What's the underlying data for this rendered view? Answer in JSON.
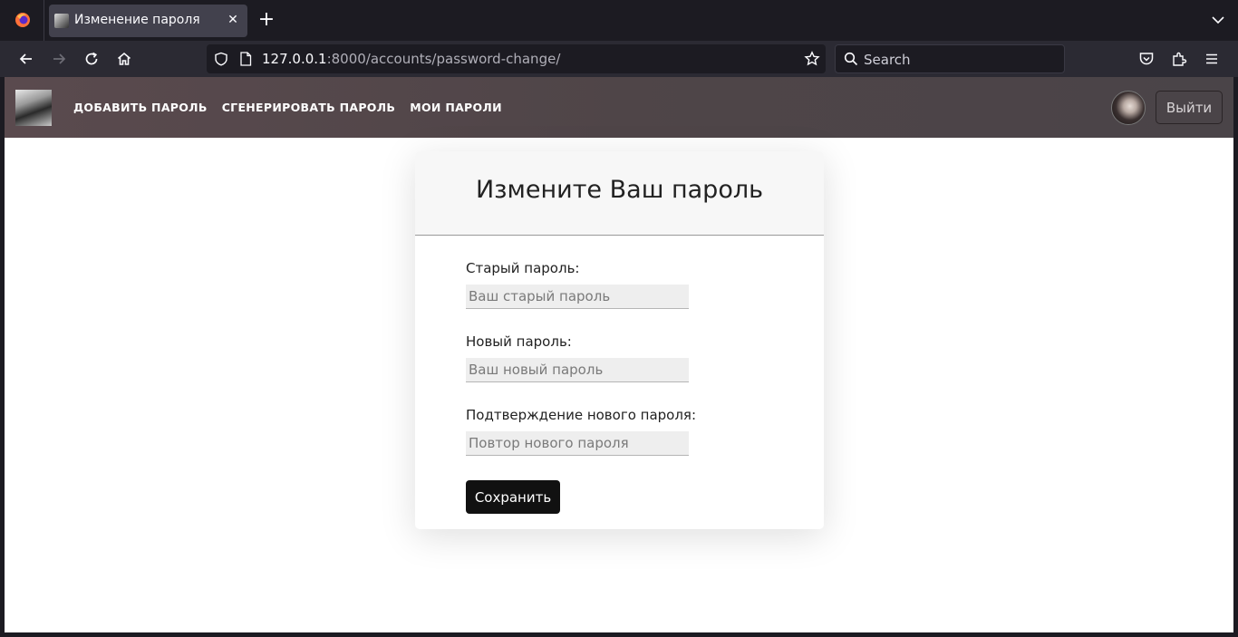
{
  "browser": {
    "tab_title": "Изменение пароля",
    "tab_close": "✕",
    "new_tab": "+",
    "url_host": "127.0.0.1",
    "url_rest": ":8000/accounts/password-change/",
    "search_placeholder": "Search",
    "icons": [
      "firefox-logo-icon",
      "back-arrow-icon",
      "forward-arrow-icon",
      "reload-icon",
      "home-icon",
      "shield-icon",
      "page-icon",
      "bookmark-star-icon",
      "search-icon",
      "pocket-icon",
      "extensions-icon",
      "menu-icon",
      "tab-list-chevron-icon"
    ]
  },
  "header": {
    "nav": [
      "ДОБАВИТЬ ПАРОЛЬ",
      "СГЕНЕРИРОВАТЬ ПАРОЛЬ",
      "МОИ ПАРОЛИ"
    ],
    "logout_label": "Выйти"
  },
  "form": {
    "title": "Измените Ваш пароль",
    "fields": [
      {
        "label": "Старый пароль:",
        "placeholder": "Ваш старый пароль",
        "value": ""
      },
      {
        "label": "Новый пароль:",
        "placeholder": "Ваш новый пароль",
        "value": ""
      },
      {
        "label": "Подтверждение нового пароля:",
        "placeholder": "Повтор нового пароля",
        "value": ""
      }
    ],
    "submit_label": "Сохранить"
  },
  "colors": {
    "header_bg": "#574a4e",
    "button_bg": "#111111",
    "chrome_bg": "#1c1b22",
    "toolbar_bg": "#2b2a33"
  }
}
